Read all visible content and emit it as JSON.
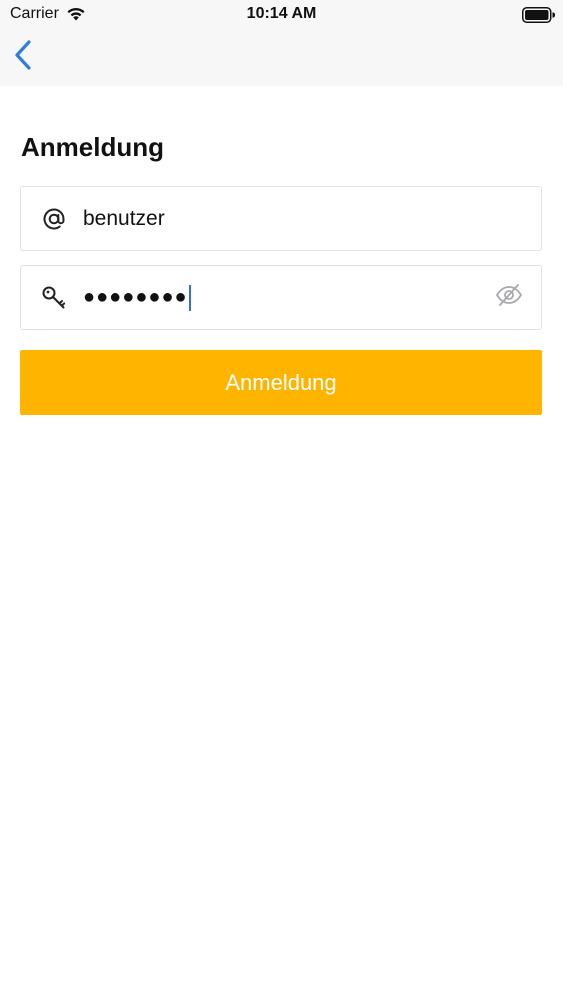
{
  "status_bar": {
    "carrier": "Carrier",
    "time": "10:14 AM",
    "wifi_icon": "wifi-icon",
    "battery_icon": "battery-icon"
  },
  "nav": {
    "back_icon": "chevron-left-icon",
    "accent_color": "#2f7de1"
  },
  "page": {
    "title": "Anmeldung"
  },
  "form": {
    "username": {
      "icon": "at-icon",
      "value": "benutzer"
    },
    "password": {
      "icon": "key-icon",
      "masked_value": "●●●●●●●●",
      "visibility_icon": "eye-slash-icon"
    },
    "submit_label": "Anmeldung",
    "submit_color": "#ffb400"
  }
}
